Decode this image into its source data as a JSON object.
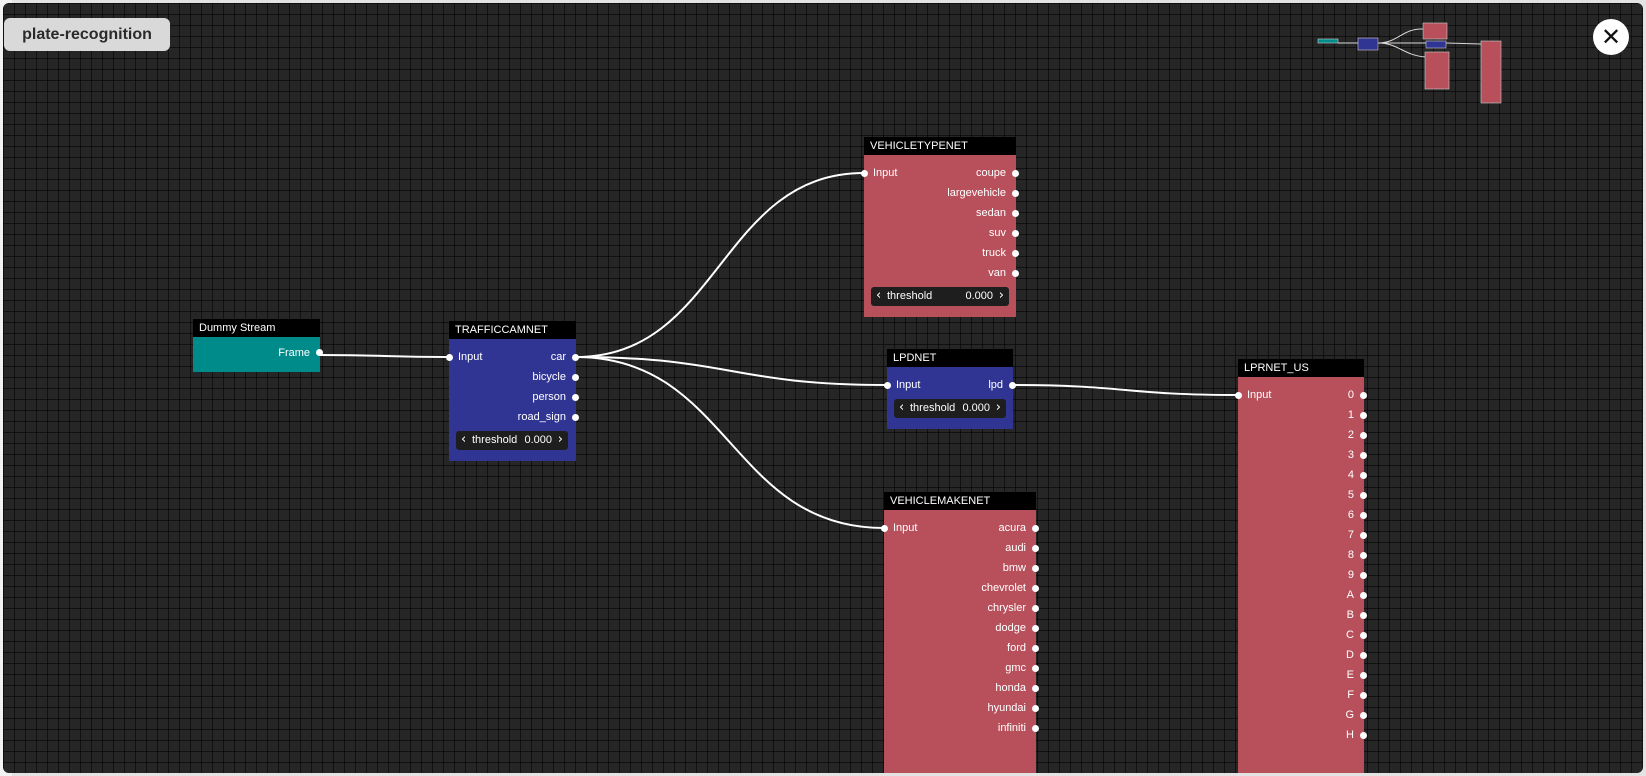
{
  "app": {
    "title": "plate-recognition",
    "close_icon": "✕"
  },
  "colors": {
    "teal": "#008b8b",
    "blue": "#303593",
    "red": "#b8505c",
    "canvas": "#262626"
  },
  "nodes": {
    "dummy_stream": {
      "title": "Dummy Stream",
      "outputs": [
        "Frame"
      ]
    },
    "trafficcamnet": {
      "title": "TRAFFICCAMNET",
      "inputs": [
        "Input"
      ],
      "outputs": [
        "car",
        "bicycle",
        "person",
        "road_sign"
      ],
      "threshold": {
        "label": "threshold",
        "value": "0.000"
      }
    },
    "vehicletypenet": {
      "title": "VEHICLETYPENET",
      "inputs": [
        "Input"
      ],
      "outputs": [
        "coupe",
        "largevehicle",
        "sedan",
        "suv",
        "truck",
        "van"
      ],
      "threshold": {
        "label": "threshold",
        "value": "0.000"
      }
    },
    "lpdnet": {
      "title": "LPDNET",
      "inputs": [
        "Input"
      ],
      "outputs": [
        "lpd"
      ],
      "threshold": {
        "label": "threshold",
        "value": "0.000"
      }
    },
    "vehiclemakenet": {
      "title": "VEHICLEMAKENET",
      "inputs": [
        "Input"
      ],
      "outputs": [
        "acura",
        "audi",
        "bmw",
        "chevrolet",
        "chrysler",
        "dodge",
        "ford",
        "gmc",
        "honda",
        "hyundai",
        "infiniti"
      ]
    },
    "lprnet_us": {
      "title": "LPRNET_US",
      "inputs": [
        "Input"
      ],
      "outputs": [
        "0",
        "1",
        "2",
        "3",
        "4",
        "5",
        "6",
        "7",
        "8",
        "9",
        "A",
        "B",
        "C",
        "D",
        "E",
        "F",
        "G",
        "H"
      ]
    }
  },
  "connections": [
    [
      "Dummy Stream.Frame",
      "TRAFFICCAMNET.Input"
    ],
    [
      "TRAFFICCAMNET.car",
      "VEHICLETYPENET.Input"
    ],
    [
      "TRAFFICCAMNET.car",
      "LPDNET.Input"
    ],
    [
      "TRAFFICCAMNET.car",
      "VEHICLEMAKENET.Input"
    ],
    [
      "LPDNET.lpd",
      "LPRNET_US.Input"
    ]
  ]
}
